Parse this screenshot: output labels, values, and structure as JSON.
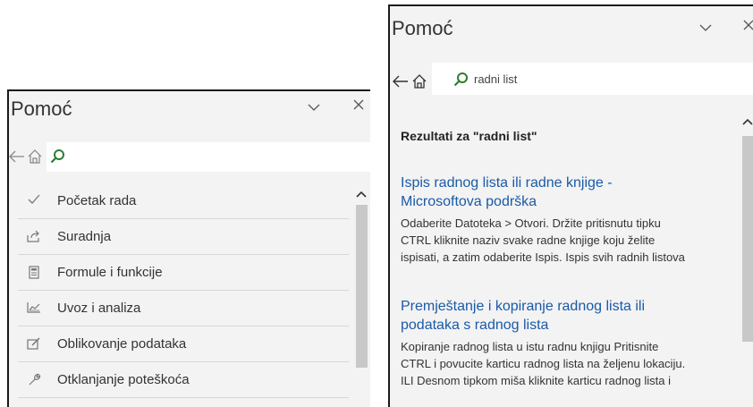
{
  "left_panel": {
    "title": "Pomoć",
    "search": {
      "value": "",
      "placeholder": ""
    },
    "items": [
      {
        "label": "Početak rada",
        "icon": "checkmark-icon"
      },
      {
        "label": "Suradnja",
        "icon": "share-icon"
      },
      {
        "label": "Formule i funkcije",
        "icon": "calculator-icon"
      },
      {
        "label": "Uvoz i analiza",
        "icon": "chart-icon"
      },
      {
        "label": "Oblikovanje podataka",
        "icon": "format-icon"
      },
      {
        "label": "Otklanjanje poteškoća",
        "icon": "wrench-icon"
      }
    ]
  },
  "right_panel": {
    "title": "Pomoć",
    "search": {
      "value": "radni list",
      "placeholder": ""
    },
    "results_heading": "Rezultati za \"radni list\"",
    "results": [
      {
        "title_line1": "Ispis radnog lista ili radne knjige -",
        "title_line2": "Microsoftova podrška",
        "snippet_line1": "Odaberite Datoteka > Otvori. Držite pritisnutu tipku",
        "snippet_line2": "CTRL kliknite naziv svake radne knjige koju želite",
        "snippet_line3": "ispisati, a zatim odaberite Ispis. Ispis svih radnih listova"
      },
      {
        "title_line1": "Premještanje i kopiranje radnog lista ili",
        "title_line2": "podataka s radnog lista",
        "snippet_line1": "Kopiranje radnog lista u istu radnu knjigu Pritisnite",
        "snippet_line2": "CTRL i povucite karticu radnog lista na željenu lokaciju.",
        "snippet_line3": "ILI Desnom tipkom miša kliknite karticu radnog lista i"
      }
    ]
  },
  "colors": {
    "panel_bg": "#f3f3f3",
    "link": "#1a5aa8",
    "search_icon": "#2e7d32",
    "border": "#1a1a1a"
  }
}
